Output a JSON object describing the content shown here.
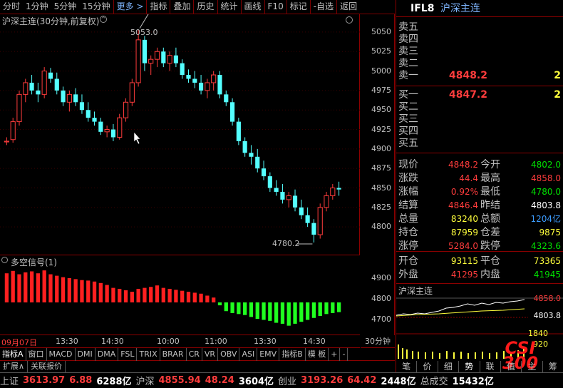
{
  "toolbar": {
    "items": [
      "分时",
      "1分钟",
      "5分钟",
      "15分钟",
      "更多 >",
      "指标",
      "叠加",
      "历史",
      "统计",
      "画线",
      "F10",
      "标记",
      "-自选",
      "返回"
    ]
  },
  "chart": {
    "title": "沪深主连(30分钟,前复权)",
    "high_label": "5053.0",
    "low_label": "4780.2",
    "y_ticks": [
      "5050",
      "5025",
      "5000",
      "4975",
      "4950",
      "4925",
      "4900",
      "4875",
      "4850",
      "4825",
      "4800"
    ],
    "sub_title": "多空信号(1)",
    "sub_y_ticks": [
      "4900",
      "4800",
      "4700"
    ],
    "time_labels": [
      "09月07日",
      "13:30",
      "14:30",
      "10:00",
      "11:00",
      "13:30",
      "14:30"
    ],
    "period": "30分钟",
    "colors": {
      "up": "#ff3c3c",
      "down": "#54ffff",
      "bull": "#ff2020",
      "bear": "#20ff20"
    }
  },
  "chart_data": {
    "type": "candlestick",
    "ohlc": [
      [
        4909,
        4915,
        4905,
        4910
      ],
      [
        4912,
        4940,
        4908,
        4935
      ],
      [
        4935,
        4975,
        4930,
        4970
      ],
      [
        4970,
        4990,
        4960,
        4985
      ],
      [
        4985,
        4995,
        4970,
        4975
      ],
      [
        4975,
        4985,
        4960,
        4970
      ],
      [
        4970,
        5005,
        4965,
        5000
      ],
      [
        4998,
        5004,
        4985,
        4990
      ],
      [
        4990,
        4998,
        4970,
        4975
      ],
      [
        4975,
        4980,
        4955,
        4960
      ],
      [
        4960,
        4975,
        4948,
        4970
      ],
      [
        4970,
        4978,
        4955,
        4960
      ],
      [
        4960,
        4970,
        4945,
        4950
      ],
      [
        4950,
        4960,
        4935,
        4940
      ],
      [
        4940,
        4948,
        4930,
        4935
      ],
      [
        4935,
        4940,
        4918,
        4922
      ],
      [
        4922,
        4930,
        4915,
        4925
      ],
      [
        4925,
        4932,
        4910,
        4915
      ],
      [
        4915,
        4945,
        4912,
        4940
      ],
      [
        4940,
        4965,
        4935,
        4960
      ],
      [
        4960,
        4990,
        4955,
        4985
      ],
      [
        4985,
        5053,
        4980,
        5040
      ],
      [
        5040,
        5045,
        5000,
        5010
      ],
      [
        5010,
        5020,
        4995,
        5015
      ],
      [
        5015,
        5030,
        5005,
        5025
      ],
      [
        5025,
        5030,
        5005,
        5010
      ],
      [
        5010,
        5025,
        5000,
        5020
      ],
      [
        5020,
        5030,
        5005,
        5010
      ],
      [
        5010,
        5015,
        4990,
        4995
      ],
      [
        4995,
        5002,
        4985,
        4990
      ],
      [
        4990,
        5000,
        4978,
        4985
      ],
      [
        4985,
        4995,
        4970,
        4975
      ],
      [
        4975,
        4990,
        4965,
        4985
      ],
      [
        4985,
        5000,
        4975,
        4995
      ],
      [
        4995,
        5000,
        4965,
        4970
      ],
      [
        4970,
        4975,
        4955,
        4960
      ],
      [
        4960,
        4965,
        4930,
        4935
      ],
      [
        4935,
        4940,
        4905,
        4910
      ],
      [
        4910,
        4915,
        4890,
        4895
      ],
      [
        4895,
        4905,
        4880,
        4890
      ],
      [
        4890,
        4900,
        4870,
        4875
      ],
      [
        4875,
        4885,
        4860,
        4865
      ],
      [
        4865,
        4870,
        4845,
        4850
      ],
      [
        4850,
        4860,
        4840,
        4845
      ],
      [
        4845,
        4855,
        4830,
        4835
      ],
      [
        4835,
        4845,
        4825,
        4840
      ],
      [
        4840,
        4848,
        4820,
        4825
      ],
      [
        4825,
        4835,
        4810,
        4815
      ],
      [
        4815,
        4825,
        4800,
        4805
      ],
      [
        4805,
        4810,
        4780,
        4790
      ],
      [
        4790,
        4830,
        4785,
        4825
      ],
      [
        4825,
        4845,
        4820,
        4840
      ],
      [
        4840,
        4855,
        4835,
        4850
      ],
      [
        4850,
        4858,
        4840,
        4848
      ]
    ],
    "signal": [
      60,
      65,
      58,
      62,
      64,
      60,
      66,
      58,
      55,
      52,
      50,
      48,
      46,
      45,
      43,
      40,
      36,
      30,
      28,
      25,
      22,
      28,
      30,
      32,
      35,
      30,
      28,
      26,
      24,
      22,
      20,
      18,
      14,
      10,
      -6,
      -18,
      -22,
      -24,
      -26,
      -30,
      -34,
      -36,
      -38,
      -42,
      -44,
      -48,
      -44,
      -40,
      -36,
      -32,
      -28,
      -24,
      -22,
      -20
    ],
    "ylim": [
      4780,
      5060
    ]
  },
  "right": {
    "header_code": "IFL8",
    "header_name": "沪深主连",
    "sell": [
      {
        "label": "卖五",
        "price": "",
        "vol": ""
      },
      {
        "label": "卖四",
        "price": "",
        "vol": ""
      },
      {
        "label": "卖三",
        "price": "",
        "vol": ""
      },
      {
        "label": "卖二",
        "price": "",
        "vol": ""
      },
      {
        "label": "卖一",
        "price": "4848.2",
        "vol": "2"
      }
    ],
    "buy": [
      {
        "label": "买一",
        "price": "4847.2",
        "vol": "2"
      },
      {
        "label": "买二",
        "price": "",
        "vol": ""
      },
      {
        "label": "买三",
        "price": "",
        "vol": ""
      },
      {
        "label": "买四",
        "price": "",
        "vol": ""
      },
      {
        "label": "买五",
        "price": "",
        "vol": ""
      }
    ],
    "quotes": [
      {
        "l1": "现价",
        "v1": "4848.2",
        "c1": "red",
        "l2": "今开",
        "v2": "4802.0",
        "c2": "green"
      },
      {
        "l1": "涨跌",
        "v1": "44.4",
        "c1": "red",
        "l2": "最高",
        "v2": "4858.0",
        "c2": "red"
      },
      {
        "l1": "涨幅",
        "v1": "0.92%",
        "c1": "red",
        "l2": "最低",
        "v2": "4780.0",
        "c2": "green"
      },
      {
        "l1": "结算",
        "v1": "4846.4",
        "c1": "red",
        "l2": "昨结",
        "v2": "4803.8",
        "c2": "white"
      },
      {
        "l1": "总量",
        "v1": "83240",
        "c1": "yellow",
        "l2": "总额",
        "v2": "1204亿",
        "c2": "blue"
      },
      {
        "l1": "持仓",
        "v1": "87959",
        "c1": "yellow",
        "l2": "仓差",
        "v2": "9875",
        "c2": "yellow"
      },
      {
        "l1": "涨停",
        "v1": "5284.0",
        "c1": "red",
        "l2": "跌停",
        "v2": "4323.6",
        "c2": "green"
      }
    ],
    "quotes2": [
      {
        "l1": "开仓",
        "v1": "93115",
        "c1": "yellow",
        "l2": "平仓",
        "v2": "73365",
        "c2": "yellow"
      },
      {
        "l1": "外盘",
        "v1": "41295",
        "c1": "red",
        "l2": "内盘",
        "v2": "41945",
        "c2": "green"
      }
    ],
    "mini_title": "沪深主连",
    "mini_price_labels": [
      "4858.0",
      "4803.8"
    ],
    "mini_vol_labels": [
      "1840",
      "920"
    ],
    "watermark": "CSI 300",
    "tabs": [
      "笔",
      "价",
      "细",
      "势",
      "联",
      "值",
      "主",
      "筹"
    ]
  },
  "indicators": [
    "指标A",
    "窗口",
    "MACD",
    "DMI",
    "DMA",
    "FSL",
    "TRIX",
    "BRAR",
    "CR",
    "VR",
    "OBV",
    "ASI",
    "EMV",
    "指标B",
    "模 板",
    "+",
    "-"
  ],
  "ext_tabs": [
    "扩展∧",
    "关联报价"
  ],
  "status": {
    "items": [
      {
        "t": "上证",
        "c": "gray"
      },
      {
        "t": "3613.97",
        "c": "red"
      },
      {
        "t": "6.88",
        "c": "red"
      },
      {
        "t": "6288亿",
        "c": "white"
      },
      {
        "t": "沪深",
        "c": "gray"
      },
      {
        "t": "4855.94",
        "c": "red"
      },
      {
        "t": "48.24",
        "c": "red"
      },
      {
        "t": "3604亿",
        "c": "white"
      },
      {
        "t": "创业",
        "c": "gray"
      },
      {
        "t": "3193.26",
        "c": "red"
      },
      {
        "t": "64.42",
        "c": "red"
      },
      {
        "t": "2448亿",
        "c": "white"
      },
      {
        "t": "总成交",
        "c": "gray"
      },
      {
        "t": "15432亿",
        "c": "white"
      }
    ]
  }
}
